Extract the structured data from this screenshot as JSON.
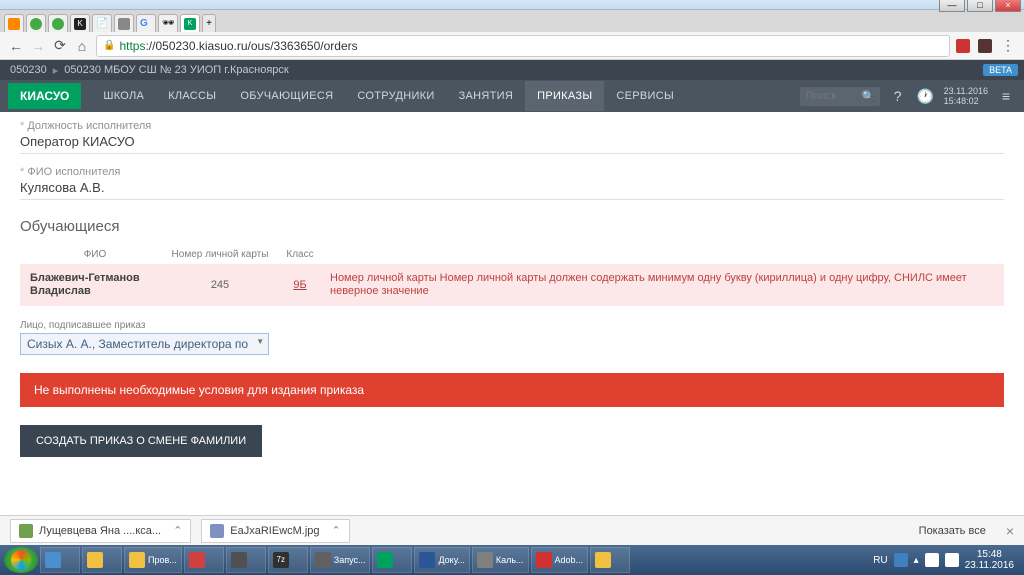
{
  "window": {
    "close": "×",
    "max": "□",
    "min": "—"
  },
  "browser": {
    "url_prefix": "https",
    "url": "://050230.kiasuo.ru/ous/3363650/orders"
  },
  "breadcrumb": {
    "code": "050230",
    "school": "050230 МБОУ СШ № 23 УИОП г.Красноярск",
    "beta": "BETA"
  },
  "nav": {
    "logo": "КИАСУО",
    "items": [
      "ШКОЛА",
      "КЛАССЫ",
      "ОБУЧАЮЩИЕСЯ",
      "СОТРУДНИКИ",
      "ЗАНЯТИЯ",
      "ПРИКАЗЫ",
      "СЕРВИСЫ"
    ],
    "active_index": 5,
    "search_placeholder": "Поиск",
    "date": "23.11.2016",
    "time": "15:48:02"
  },
  "form": {
    "position_label": "Должность исполнителя",
    "position_value": "Оператор КИАСУО",
    "fio_label": "ФИО исполнителя",
    "fio_value": "Кулясова А.В."
  },
  "students": {
    "title": "Обучающиеся",
    "headers": {
      "fio": "ФИО",
      "card": "Номер личной карты",
      "class": "Класс"
    },
    "row": {
      "name": "Блажевич-Гетманов Владислав",
      "card": "245",
      "class": "9Б",
      "error": "Номер личной карты Номер личной карты должен содержать минимум одну букву (кириллица) и одну цифру, СНИЛС имеет неверное значение"
    }
  },
  "signer": {
    "label": "Лицо, подписавшее приказ",
    "value": "Сизых А. А., Заместитель директора по"
  },
  "alert": "Не выполнены необходимые условия для издания приказа",
  "action_button": "СОЗДАТЬ ПРИКАЗ О СМЕНЕ ФАМИЛИИ",
  "downloads": {
    "item1": "Лущевцева Яна ....кса...",
    "item2": "EaJxaRIEwcM.jpg",
    "show_all": "Показать все"
  },
  "taskbar": {
    "items": [
      "",
      "",
      "Пров...",
      "",
      "",
      "7z",
      "Запус...",
      "",
      "Доку...",
      "Каль...",
      "Adob...",
      ""
    ],
    "lang": "RU",
    "clock_time": "15:48",
    "clock_date": "23.11.2016"
  }
}
